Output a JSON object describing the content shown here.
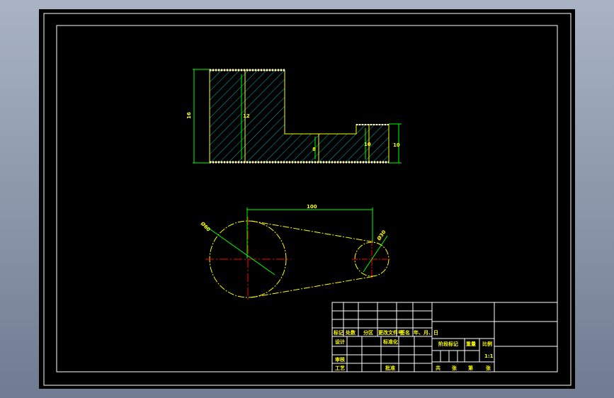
{
  "drawing": {
    "background_color": "#000000",
    "frame_color": "#ffffff",
    "part_color": "#ffff00",
    "dimension_color": "#00ff00",
    "hatch_color": "#00c8c8",
    "centerline_color": "#ff0000",
    "dimensions": {
      "left_height": "16",
      "inner_height": "12",
      "step_height": "8",
      "slot_height": "10",
      "right_height": "10",
      "center_distance": "100",
      "large_diameter": "Ø60",
      "small_diameter": "Ø30"
    }
  },
  "title_block": {
    "row_headers": [
      "标记",
      "处数",
      "分区",
      "更改文件号",
      "签名",
      "年、月、日"
    ],
    "design": "设计",
    "standardization": "标准化",
    "review": "审核",
    "process": "工艺",
    "approve": "批准",
    "stage_mark": "阶段标记",
    "weight": "重量",
    "scale": "比例",
    "scale_value": "1:1",
    "sheets_total": "共",
    "sheets_unit1": "张",
    "sheet_no": "第",
    "sheets_unit2": "张"
  }
}
